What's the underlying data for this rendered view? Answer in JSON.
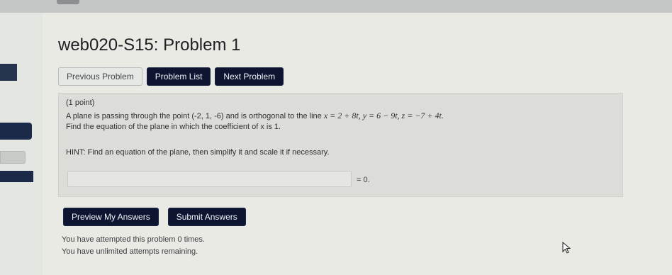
{
  "title": "web020-S15: Problem 1",
  "nav": {
    "previous": "Previous Problem",
    "list": "Problem List",
    "next": "Next Problem"
  },
  "problem": {
    "points": "(1 point)",
    "statement_prefix": "A plane is passing through the point (-2, 1, -6) and is orthogonal to the line ",
    "line_equation": "x = 2 + 8t,  y = 6 − 9t,  z = −7 + 4t.",
    "question": "Find the equation of the plane in which the coefficient of x is 1.",
    "hint": "HINT: Find an equation of the plane, then simplify it and scale it if necessary.",
    "answer_value": "",
    "equals_zero": "= 0."
  },
  "actions": {
    "preview": "Preview My Answers",
    "submit": "Submit Answers"
  },
  "status": {
    "attempted": "You have attempted this problem 0 times.",
    "remaining": "You have unlimited attempts remaining."
  },
  "icons": {
    "cursor": "mouse-pointer-icon"
  }
}
